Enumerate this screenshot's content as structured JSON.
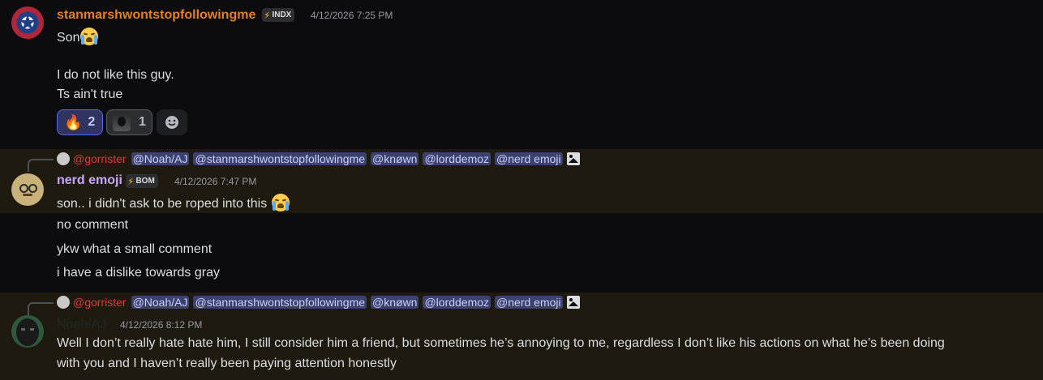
{
  "messages": [
    {
      "username": "stanmarshwontstopfollowingme",
      "username_color": "#e67e22",
      "badge": "INDX",
      "timestamp": "4/12/2026 7:25 PM",
      "lines": [
        "Son",
        "I do not like this guy.",
        "Ts ain't true"
      ],
      "reactions": [
        {
          "icon": "fire-emoji",
          "count": "2",
          "selected": true
        },
        {
          "icon": "avatar-emoji",
          "count": "1",
          "selected": false
        },
        {
          "icon": "add-reaction-icon"
        }
      ]
    },
    {
      "reply": {
        "author_mention": "@gorrister",
        "mentions": [
          "@Noah/AJ",
          "@stanmarshwontstopfollowingme",
          "@knøwn",
          "@lorddemoz",
          "@nerd emoji"
        ]
      },
      "username": "nerd emoji",
      "username_color": "#c9a7ff",
      "badge": "BOM",
      "timestamp": "4/12/2026 7:47 PM",
      "lines": [
        "son.. i didn't ask to be roped into this",
        "no comment",
        "ykw what a small  comment",
        "i have a dislike towards gray"
      ]
    },
    {
      "reply": {
        "author_mention": "@gorrister",
        "mentions": [
          "@Noah/AJ",
          "@stanmarshwontstopfollowingme",
          "@knøwn",
          "@lorddemoz",
          "@nerd emoji"
        ]
      },
      "username": "Noah/AJ",
      "username_color": "#1f2a24",
      "timestamp": "4/12/2026 8:12 PM",
      "lines": [
        "Well I don’t really hate hate him, I still consider him a friend, but sometimes he’s annoying to me, regardless I don’t like his actions on what he’s been doing",
        "with you and I haven’t really been paying attention honestly"
      ]
    }
  ],
  "colors": {
    "background": "#0c0c0e",
    "highlight_background": "#1f1a10",
    "mention_background": "#3c4270",
    "mention_text": "#c9cdfb",
    "reply_author": "#d83c3e"
  }
}
